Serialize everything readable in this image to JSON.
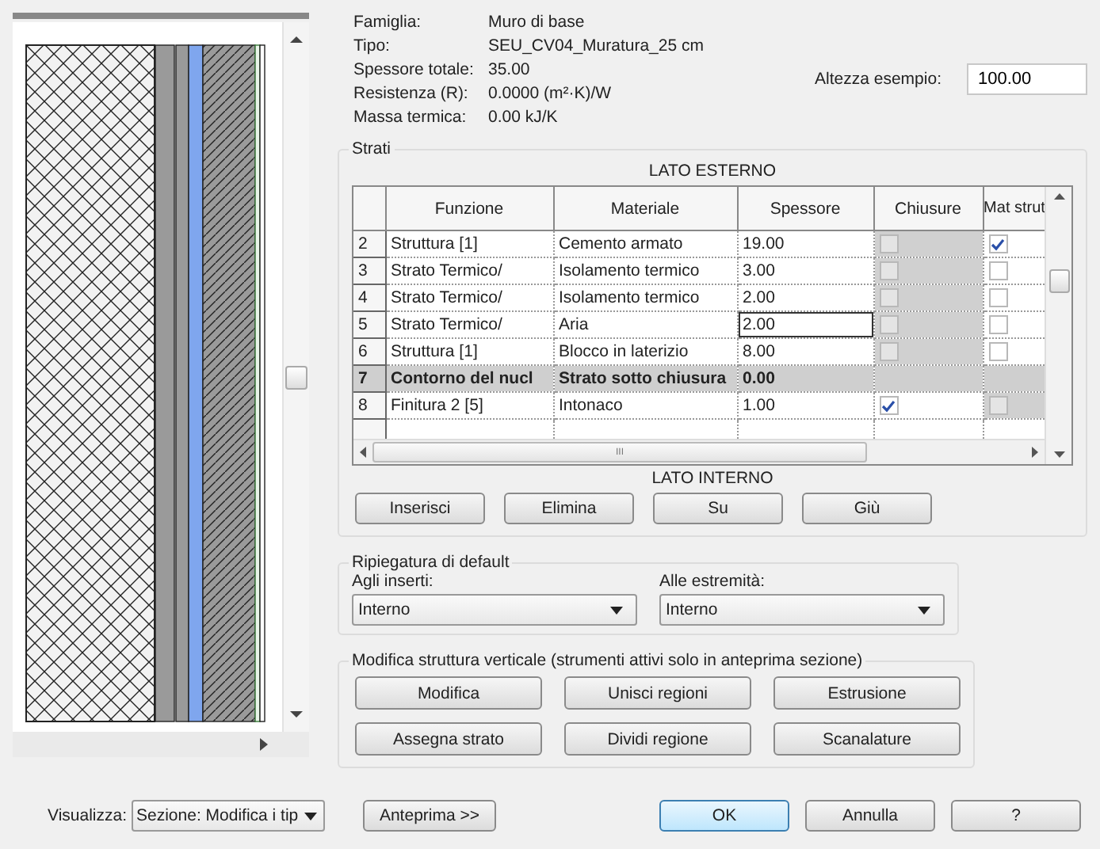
{
  "properties": [
    {
      "label": "Famiglia:",
      "value": "Muro di base"
    },
    {
      "label": "Tipo:",
      "value": "SEU_CV04_Muratura_25 cm"
    },
    {
      "label": "Spessore totale:",
      "value": "35.00"
    },
    {
      "label": "Resistenza (R):",
      "value": "0.0000 (m²·K)/W"
    },
    {
      "label": "Massa termica:",
      "value": "0.00 kJ/K"
    }
  ],
  "sample_height": {
    "label": "Altezza esempio:",
    "value": "100.00"
  },
  "layers": {
    "title": "Strati",
    "top_label": "LATO ESTERNO",
    "bottom_label": "LATO INTERNO",
    "columns": [
      "Funzione",
      "Materiale",
      "Spessore",
      "Chiusure",
      "Mat strut"
    ],
    "rows": [
      {
        "num": "2",
        "kind": "layer",
        "function": "Struttura [1]",
        "material": "Cemento armato",
        "thickness": "19.00",
        "thickness_selected": false,
        "wraps": {
          "checked": false,
          "disabled": true
        },
        "structural": {
          "checked": true,
          "disabled": false
        }
      },
      {
        "num": "3",
        "kind": "layer",
        "function": "Strato Termico/",
        "material": "Isolamento termico",
        "thickness": "3.00",
        "thickness_selected": false,
        "wraps": {
          "checked": false,
          "disabled": true
        },
        "structural": {
          "checked": false,
          "disabled": false
        }
      },
      {
        "num": "4",
        "kind": "layer",
        "function": "Strato Termico/",
        "material": "Isolamento termico",
        "thickness": "2.00",
        "thickness_selected": false,
        "wraps": {
          "checked": false,
          "disabled": true
        },
        "structural": {
          "checked": false,
          "disabled": false
        }
      },
      {
        "num": "5",
        "kind": "layer",
        "function": "Strato Termico/",
        "material": "Aria",
        "thickness": "2.00",
        "thickness_selected": true,
        "wraps": {
          "checked": false,
          "disabled": true
        },
        "structural": {
          "checked": false,
          "disabled": false
        }
      },
      {
        "num": "6",
        "kind": "layer",
        "function": "Struttura [1]",
        "material": "Blocco in laterizio",
        "thickness": "8.00",
        "thickness_selected": false,
        "wraps": {
          "checked": false,
          "disabled": true
        },
        "structural": {
          "checked": false,
          "disabled": false
        }
      },
      {
        "num": "7",
        "kind": "boundary",
        "function": "Contorno del nucl",
        "material": "Strato sotto chiusura",
        "thickness": "0.00"
      },
      {
        "num": "8",
        "kind": "layer",
        "function": "Finitura 2 [5]",
        "material": "Intonaco",
        "thickness": "1.00",
        "thickness_selected": false,
        "wraps": {
          "checked": true,
          "disabled": false
        },
        "structural": {
          "checked": false,
          "disabled": true
        }
      }
    ],
    "scroll_label": "III",
    "buttons": [
      "Inserisci",
      "Elimina",
      "Su",
      "Giù"
    ]
  },
  "wrapping": {
    "title": "Ripiegatura di default",
    "fields": [
      {
        "label": "Agli inserti:",
        "value": "Interno"
      },
      {
        "label": "Alle estremità:",
        "value": "Interno"
      }
    ]
  },
  "vertical": {
    "title": "Modifica struttura verticale (strumenti attivi solo in anteprima sezione)",
    "buttons": [
      "Modifica",
      "Unisci regioni",
      "Estrusione",
      "Assegna strato",
      "Dividi regione",
      "Scanalature"
    ]
  },
  "view": {
    "label": "Visualizza:",
    "value": "Sezione: Modifica i tip"
  },
  "preview_button": "Anteprima >>",
  "dialog_buttons": [
    {
      "label": "OK",
      "default": true
    },
    {
      "label": "Annulla",
      "default": false
    },
    {
      "label": "?",
      "default": false
    }
  ]
}
